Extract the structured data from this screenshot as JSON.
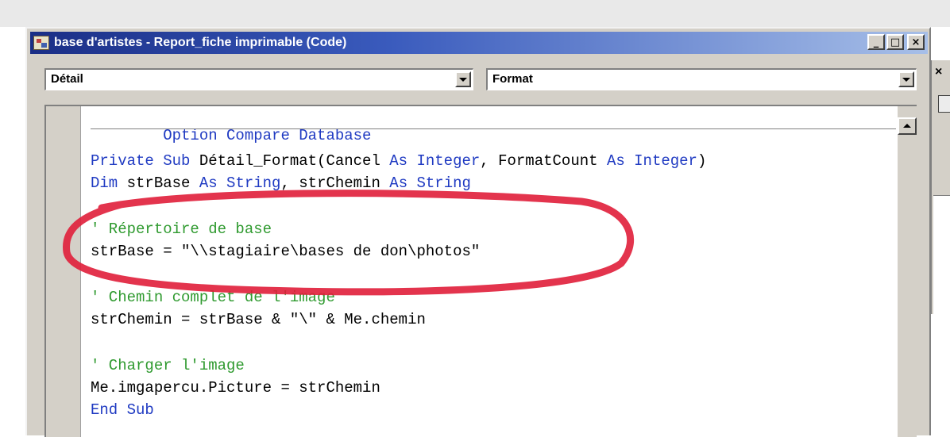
{
  "window": {
    "title": "base d'artistes - Report_fiche imprimable (Code)",
    "controls": {
      "minimize": "_",
      "maximize": "□",
      "close": "×"
    }
  },
  "object_combo": {
    "value": "Détail"
  },
  "procedure_combo": {
    "value": "Format"
  },
  "code": {
    "line1": "Option Compare Database",
    "line3_kw1": "Private Sub",
    "line3_t1": " Détail_Format(Cancel ",
    "line3_kw2": "As Integer",
    "line3_t2": ", FormatCount ",
    "line3_kw3": "As Integer",
    "line3_t3": ")",
    "line4_kw1": "Dim",
    "line4_t1": " strBase ",
    "line4_kw2": "As String",
    "line4_t2": ", strChemin ",
    "line4_kw3": "As String",
    "line6_comment": "' Répertoire de base",
    "line7": "strBase = \"\\\\stagiaire\\bases de don\\photos\"",
    "line9_comment": "' Chemin complet de l'image",
    "line10": "strChemin = strBase & \"\\\" & Me.chemin",
    "line12_comment": "' Charger l'image",
    "line13": "Me.imgapercu.Picture = strChemin",
    "line14": "End Sub"
  },
  "background_window": {
    "close_glyph": "×"
  },
  "colors": {
    "keyword": "#1f3ac2",
    "comment": "#2f9a2f",
    "annotation": "#e01e3a",
    "titlebar_start": "#1a2e86"
  },
  "annotation": {
    "shape": "hand-drawn red ellipse",
    "encircles": "comment and strBase assignment"
  }
}
